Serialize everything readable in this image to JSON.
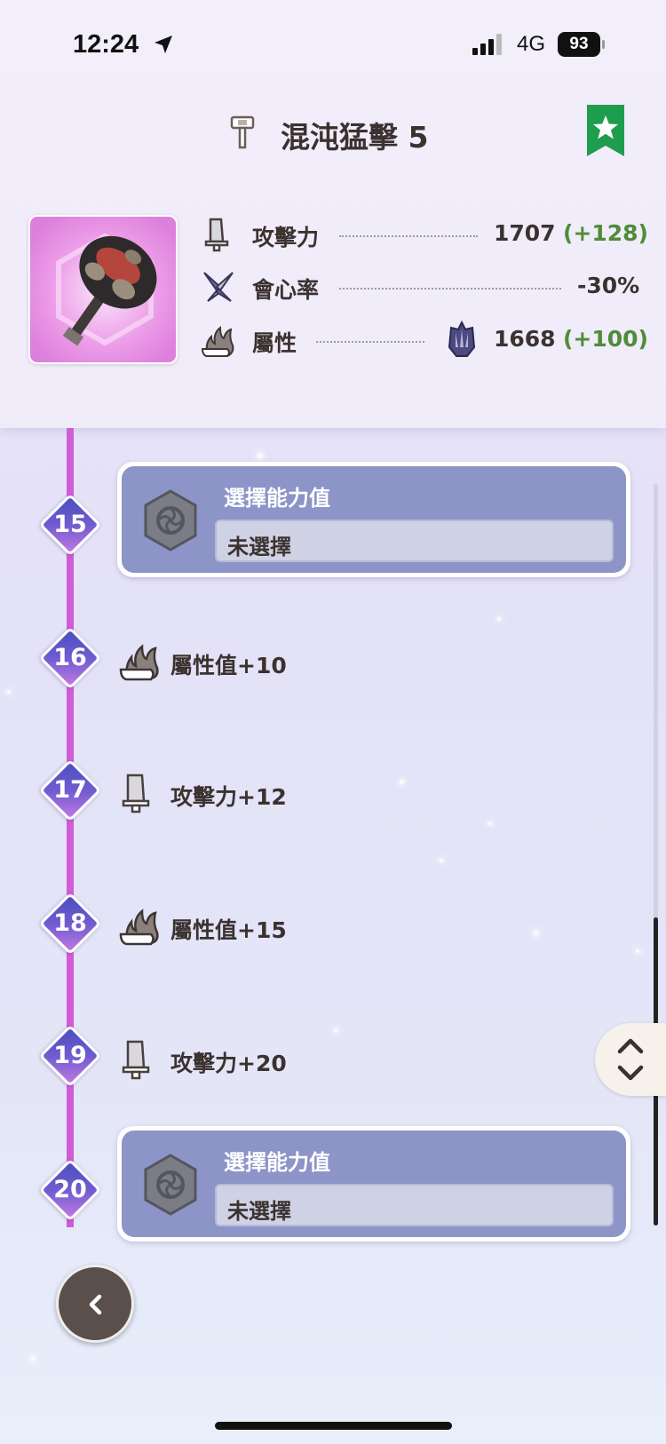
{
  "status_bar": {
    "time": "12:24",
    "network": "4G",
    "battery": "93"
  },
  "header": {
    "title": "混沌猛擊 5",
    "stats": [
      {
        "label": "攻擊力",
        "value": "1707",
        "bonus": "(+128)",
        "icon": "attack-icon"
      },
      {
        "label": "會心率",
        "value": "-30%",
        "bonus": "",
        "icon": "affinity-icon"
      },
      {
        "label": "屬性",
        "value": "1668",
        "bonus": "(+100)",
        "icon": "element-icon",
        "element_icon": "dragon-element-icon"
      }
    ]
  },
  "timeline": {
    "levels": [
      "15",
      "16",
      "17",
      "18",
      "19",
      "20"
    ],
    "select_cards": [
      {
        "title": "選擇能力值",
        "value": "未選擇"
      },
      {
        "title": "選擇能力值",
        "value": "未選擇"
      }
    ],
    "rewards": [
      {
        "text": "屬性值+10",
        "icon": "element-icon"
      },
      {
        "text": "攻擊力+12",
        "icon": "attack-icon"
      },
      {
        "text": "屬性值+15",
        "icon": "element-icon"
      },
      {
        "text": "攻擊力+20",
        "icon": "attack-icon"
      }
    ]
  },
  "colors": {
    "timeline": "#d05cd8",
    "card": "#8c94c8",
    "bonus": "#4e8c3a",
    "bookmark": "#1f9d4f"
  }
}
